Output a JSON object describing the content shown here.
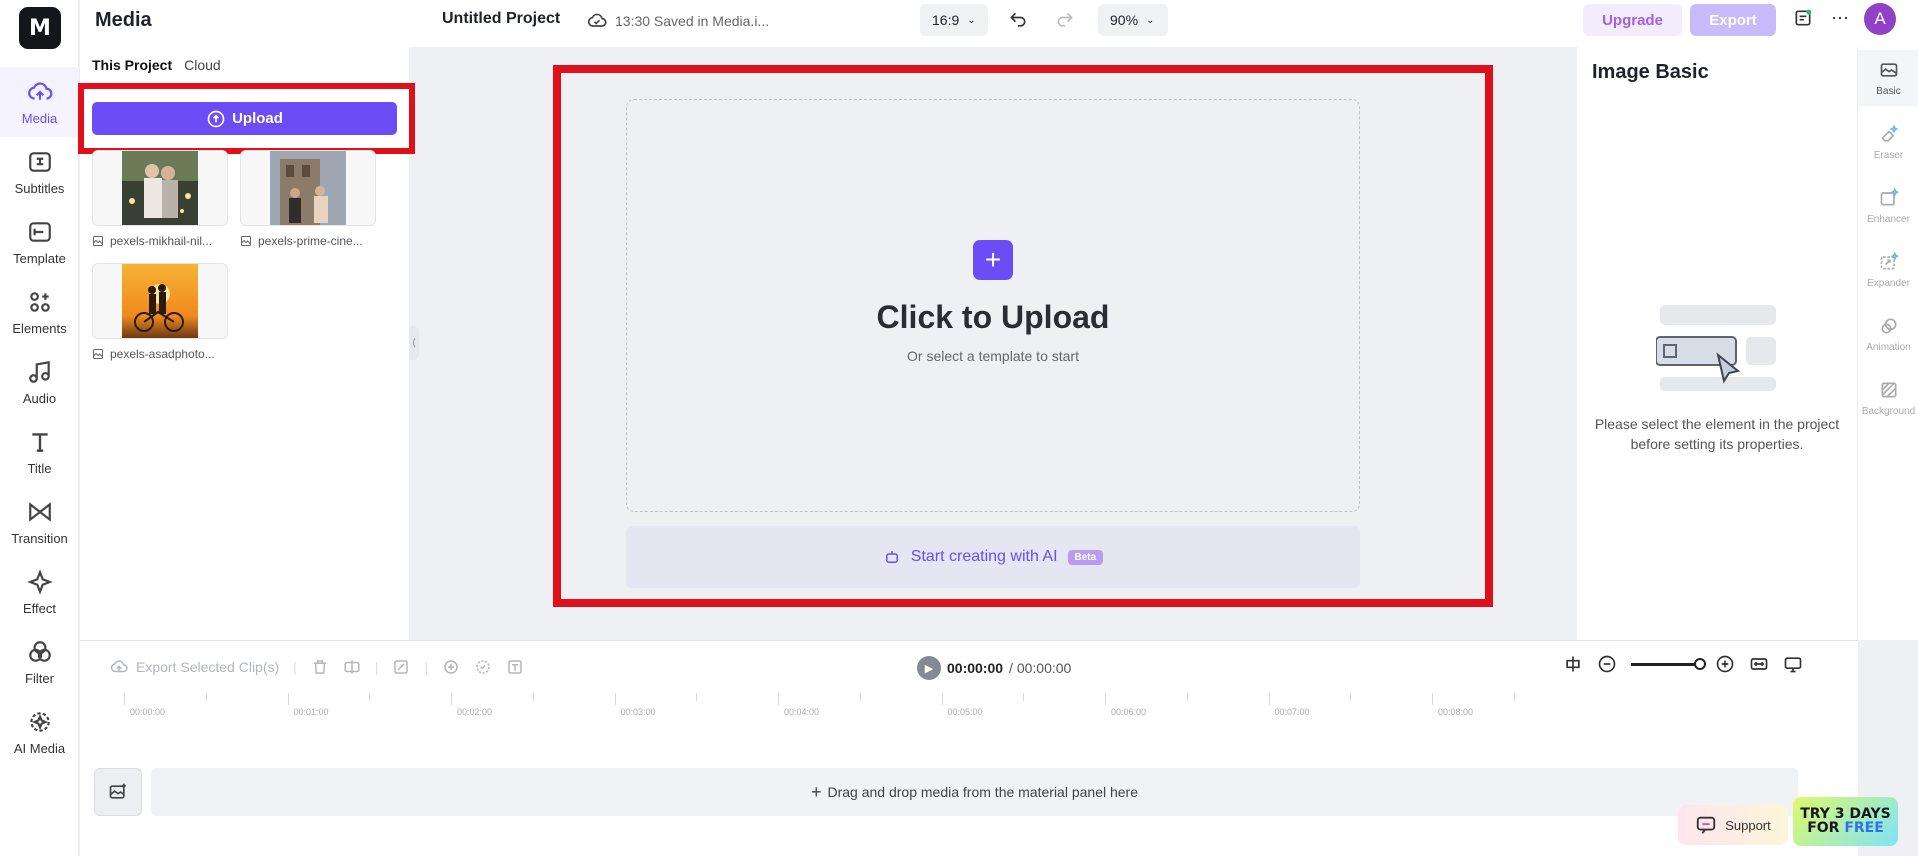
{
  "app": {
    "logo_text": "M",
    "colors": {
      "accent": "#6a4df5",
      "highlight": "#e0101a",
      "upgrade": "#a060e8",
      "export_disabled": "#c8bbfb"
    }
  },
  "nav": {
    "items": [
      {
        "label": "Media",
        "icon": "cloud-upload-icon"
      },
      {
        "label": "Subtitles",
        "icon": "subtitles-icon"
      },
      {
        "label": "Template",
        "icon": "template-icon"
      },
      {
        "label": "Elements",
        "icon": "elements-icon"
      },
      {
        "label": "Audio",
        "icon": "music-note-icon"
      },
      {
        "label": "Title",
        "icon": "text-t-icon"
      },
      {
        "label": "Transition",
        "icon": "transition-icon"
      },
      {
        "label": "Effect",
        "icon": "sparkle-icon"
      },
      {
        "label": "Filter",
        "icon": "filter-icon"
      },
      {
        "label": "AI Media",
        "icon": "ai-media-icon"
      }
    ]
  },
  "media_panel": {
    "title": "Media",
    "tabs": [
      "This Project",
      "Cloud"
    ],
    "upload_label": "Upload",
    "files": [
      {
        "name": "pexels-mikhail-nil..."
      },
      {
        "name": "pexels-prime-cine..."
      },
      {
        "name": "pexels-asadphoto..."
      }
    ]
  },
  "topbar": {
    "project_title": "Untitled Project",
    "save_status": "13:30 Saved in Media.i...",
    "aspect_ratio": "16:9",
    "zoom": "90%",
    "upgrade_label": "Upgrade",
    "export_label": "Export",
    "avatar_letter": "A"
  },
  "canvas": {
    "headline": "Click to Upload",
    "subline": "Or select a template to start",
    "ai_label": "Start creating with AI",
    "beta_label": "Beta"
  },
  "properties": {
    "title": "Image Basic",
    "message": "Please select the element in the project before setting its properties.",
    "tabs": [
      {
        "label": "Basic",
        "icon": "image-basic-icon"
      },
      {
        "label": "Eraser",
        "icon": "eraser-icon"
      },
      {
        "label": "Enhancer",
        "icon": "enhancer-icon"
      },
      {
        "label": "Expander",
        "icon": "expander-icon"
      },
      {
        "label": "Animation",
        "icon": "animation-icon"
      },
      {
        "label": "Background",
        "icon": "background-icon"
      }
    ]
  },
  "timeline": {
    "export_clips_label": "Export Selected Clip(s)",
    "current_time": "00:00:00",
    "total_time": "/ 00:00:00",
    "ruler": [
      "00:00:00",
      "00:01:00",
      "00:02:00",
      "00:03:00",
      "00:04:00",
      "00:05:00",
      "00:06:00",
      "00:07:00",
      "00:08:00"
    ],
    "drop_hint": "Drag and drop media from the material panel here"
  },
  "footer": {
    "support_label": "Support",
    "trial_line1": "TRY 3 DAYS",
    "trial_line2a": "FOR ",
    "trial_line2b": "FREE"
  }
}
